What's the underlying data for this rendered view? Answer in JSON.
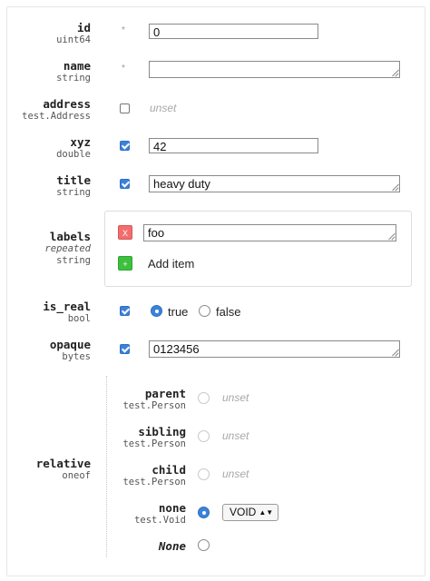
{
  "fields": {
    "id": {
      "name": "id",
      "type": "uint64",
      "marker": "*",
      "value": "0"
    },
    "name": {
      "name": "name",
      "type": "string",
      "marker": "*",
      "value": ""
    },
    "address": {
      "name": "address",
      "type": "test.Address",
      "unset": "unset",
      "checked": false
    },
    "xyz": {
      "name": "xyz",
      "type": "double",
      "value": "42",
      "checked": true
    },
    "title": {
      "name": "title",
      "type": "string",
      "value": "heavy duty",
      "checked": true
    },
    "labels": {
      "name": "labels",
      "modifier": "repeated",
      "type": "string",
      "items": [
        "foo"
      ],
      "remove_glyph": "X",
      "add_glyph": "+",
      "add_label": "Add item"
    },
    "is_real": {
      "name": "is_real",
      "type": "bool",
      "checked": true,
      "options": [
        "true",
        "false"
      ],
      "selected": "true"
    },
    "opaque": {
      "name": "opaque",
      "type": "bytes",
      "value": "0123456",
      "checked": true
    },
    "relative": {
      "name": "relative",
      "type": "oneof",
      "options": [
        {
          "name": "parent",
          "type": "test.Person",
          "unset": "unset"
        },
        {
          "name": "sibling",
          "type": "test.Person",
          "unset": "unset"
        },
        {
          "name": "child",
          "type": "test.Person",
          "unset": "unset"
        },
        {
          "name": "none",
          "type": "test.Void",
          "value": "VOID",
          "arrows": "▲▼"
        },
        {
          "name": "None"
        }
      ],
      "selected": "none"
    }
  },
  "colors": {
    "accent": "#3b82d9",
    "remove": "#f26d6d",
    "add": "#3fbf3f",
    "unset": "#a8a8a8"
  }
}
